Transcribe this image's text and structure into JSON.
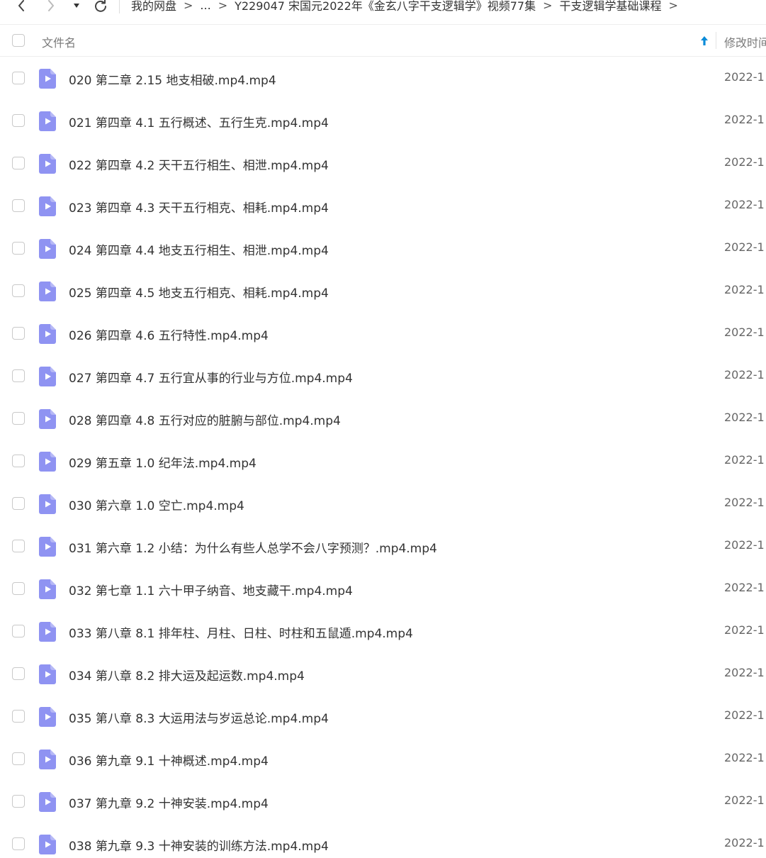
{
  "breadcrumb": {
    "items": [
      "我的网盘",
      "...",
      "Y229047 宋国元2022年《金玄八字干支逻辑学》视频77集",
      "干支逻辑学基础课程"
    ],
    "separator": ">"
  },
  "header": {
    "name_label": "文件名",
    "time_label": "修改时间"
  },
  "colors": {
    "file_icon": "#8f93f2",
    "sort_arrow": "#0a8bd8"
  },
  "files": [
    {
      "name": "020 第二章 2.15 地支相破.mp4.mp4",
      "time": "2022-1"
    },
    {
      "name": "021 第四章 4.1 五行概述、五行生克.mp4.mp4",
      "time": "2022-1"
    },
    {
      "name": "022 第四章 4.2 天干五行相生、相泄.mp4.mp4",
      "time": "2022-1"
    },
    {
      "name": "023 第四章 4.3 天干五行相克、相耗.mp4.mp4",
      "time": "2022-1"
    },
    {
      "name": "024 第四章 4.4 地支五行相生、相泄.mp4.mp4",
      "time": "2022-1"
    },
    {
      "name": "025 第四章 4.5 地支五行相克、相耗.mp4.mp4",
      "time": "2022-1"
    },
    {
      "name": "026 第四章 4.6 五行特性.mp4.mp4",
      "time": "2022-1"
    },
    {
      "name": "027 第四章 4.7 五行宜从事的行业与方位.mp4.mp4",
      "time": "2022-1"
    },
    {
      "name": "028 第四章 4.8 五行对应的脏腑与部位.mp4.mp4",
      "time": "2022-1"
    },
    {
      "name": "029 第五章 1.0 纪年法.mp4.mp4",
      "time": "2022-1"
    },
    {
      "name": "030 第六章 1.0 空亡.mp4.mp4",
      "time": "2022-1"
    },
    {
      "name": "031 第六章 1.2 小结：为什么有些人总学不会八字预测？.mp4.mp4",
      "time": "2022-1"
    },
    {
      "name": "032 第七章 1.1 六十甲子纳音、地支藏干.mp4.mp4",
      "time": "2022-1"
    },
    {
      "name": "033 第八章 8.1 排年柱、月柱、日柱、时柱和五鼠遁.mp4.mp4",
      "time": "2022-1"
    },
    {
      "name": "034 第八章 8.2 排大运及起运数.mp4.mp4",
      "time": "2022-1"
    },
    {
      "name": "035 第八章 8.3 大运用法与岁运总论.mp4.mp4",
      "time": "2022-1"
    },
    {
      "name": "036 第九章 9.1 十神概述.mp4.mp4",
      "time": "2022-1"
    },
    {
      "name": "037 第九章 9.2 十神安装.mp4.mp4",
      "time": "2022-1"
    },
    {
      "name": "038 第九章 9.3 十神安装的训练方法.mp4.mp4",
      "time": "2022-1"
    }
  ]
}
